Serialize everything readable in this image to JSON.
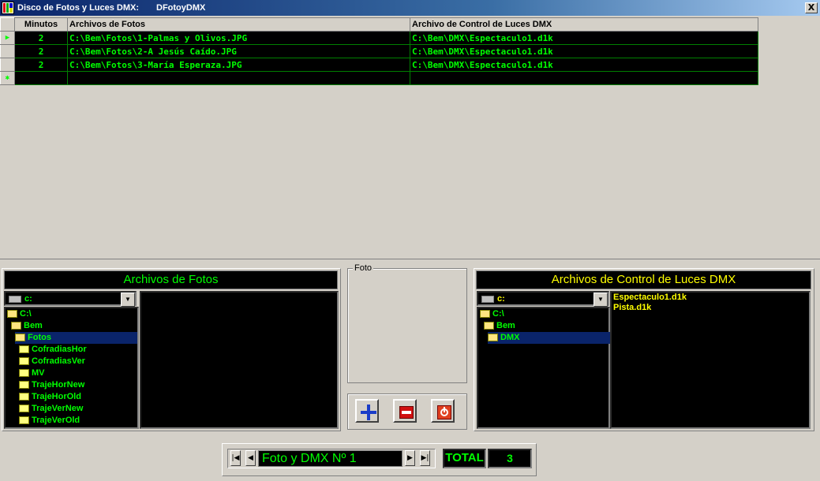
{
  "window": {
    "title": "Disco de Fotos y Luces DMX:",
    "subtitle": "DFotoyDMX",
    "close_label": "X"
  },
  "grid": {
    "columns": [
      "Minutos",
      "Archivos de Fotos",
      "Archivo de Control de Luces DMX"
    ],
    "rows": [
      {
        "minutos": "2",
        "foto": "C:\\Bem\\Fotos\\1-Palmas y Olivos.JPG",
        "dmx": "C:\\Bem\\DMX\\Espectaculo1.d1k"
      },
      {
        "minutos": "2",
        "foto": "C:\\Bem\\Fotos\\2-A Jesús Caído.JPG",
        "dmx": "C:\\Bem\\DMX\\Espectaculo1.d1k"
      },
      {
        "minutos": "2",
        "foto": "C:\\Bem\\Fotos\\3-María Esperaza.JPG",
        "dmx": "C:\\Bem\\DMX\\Espectaculo1.d1k"
      }
    ],
    "current_marker": "▶",
    "new_marker": "✱"
  },
  "fotos_panel": {
    "title": "Archivos de Fotos",
    "drive": "c:",
    "dirs": [
      {
        "name": "C:\\",
        "open": true,
        "selected": false
      },
      {
        "name": "Bem",
        "open": true,
        "selected": false
      },
      {
        "name": "Fotos",
        "open": true,
        "selected": true
      },
      {
        "name": "CofradiasHor",
        "open": false,
        "selected": false
      },
      {
        "name": "CofradiasVer",
        "open": false,
        "selected": false
      },
      {
        "name": "MV",
        "open": false,
        "selected": false
      },
      {
        "name": "TrajeHorNew",
        "open": false,
        "selected": false
      },
      {
        "name": "TrajeHorOld",
        "open": false,
        "selected": false
      },
      {
        "name": "TrajeVerNew",
        "open": false,
        "selected": false
      },
      {
        "name": "TrajeVerOld",
        "open": false,
        "selected": false
      }
    ]
  },
  "foto_group": {
    "label": "Foto"
  },
  "dmx_panel": {
    "title": "Archivos de Control de Luces DMX",
    "drive": "c:",
    "dirs": [
      {
        "name": "C:\\",
        "open": true,
        "selected": false
      },
      {
        "name": "Bem",
        "open": true,
        "selected": false
      },
      {
        "name": "DMX",
        "open": true,
        "selected": true
      }
    ],
    "files": [
      "Espectaculo1.d1k",
      "Pista.d1k"
    ]
  },
  "navigator": {
    "caption": "Foto y DMX Nº 1",
    "total_label": "TOTAL",
    "total_value": "3"
  },
  "colors": {
    "accent_green": "#00ff00",
    "accent_yellow": "#ffff00",
    "title_bar": "#0a246a",
    "add_button": "#1a3cc8",
    "remove_button": "#d01010",
    "exit_button": "#e04020"
  }
}
